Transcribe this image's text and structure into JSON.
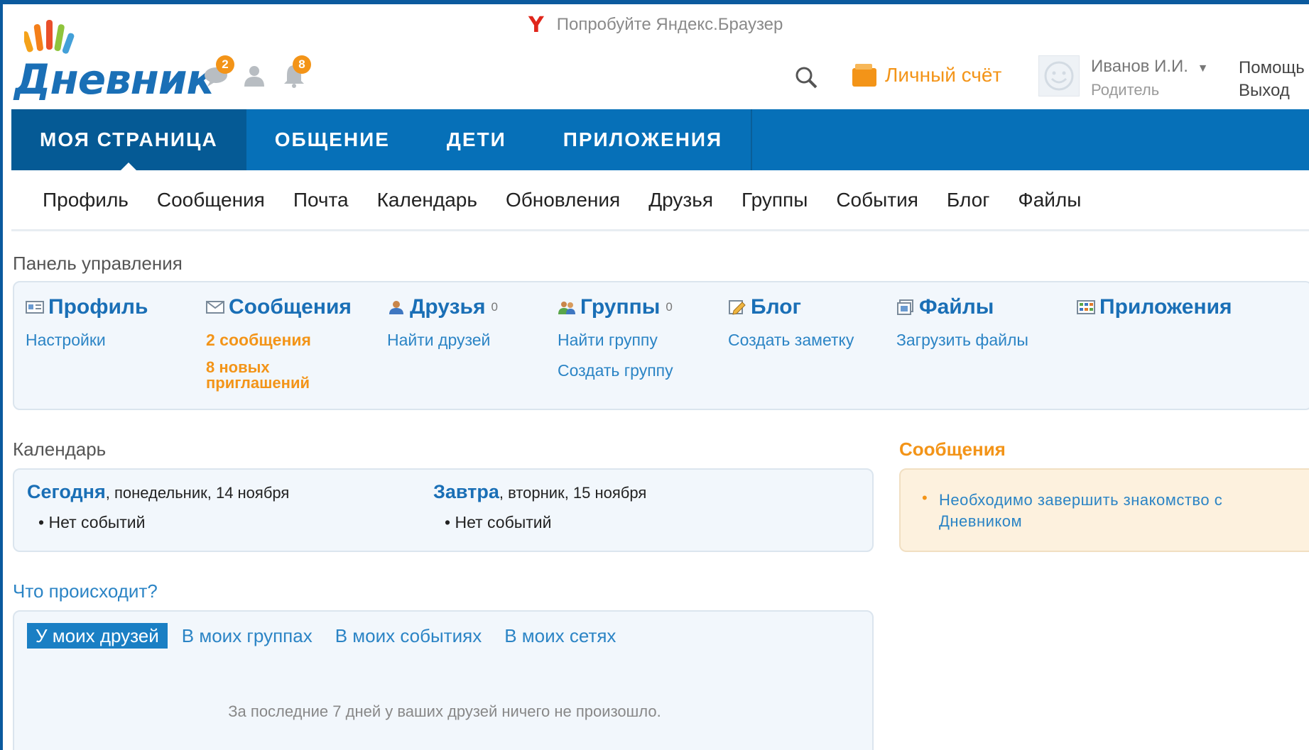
{
  "promo": {
    "text": "Попробуйте Яндекс.Браузер"
  },
  "logo": {
    "text": "Дневник"
  },
  "header": {
    "messages_badge": "2",
    "notifications_badge": "8",
    "account_label": "Личный счёт",
    "user_name": "Иванов И.И.",
    "user_role": "Родитель",
    "help_link": "Помощь",
    "logout_link": "Выход"
  },
  "main_nav": [
    {
      "label": "МОЯ СТРАНИЦА"
    },
    {
      "label": "ОБЩЕНИЕ"
    },
    {
      "label": "ДЕТИ"
    },
    {
      "label": "ПРИЛОЖЕНИЯ"
    }
  ],
  "sub_nav": [
    {
      "label": "Профиль"
    },
    {
      "label": "Сообщения"
    },
    {
      "label": "Почта"
    },
    {
      "label": "Календарь"
    },
    {
      "label": "Обновления"
    },
    {
      "label": "Друзья"
    },
    {
      "label": "Группы"
    },
    {
      "label": "События"
    },
    {
      "label": "Блог"
    },
    {
      "label": "Файлы"
    }
  ],
  "panel": {
    "title": "Панель управления",
    "profile": {
      "title": "Профиль",
      "link1": "Настройки"
    },
    "messages": {
      "title": "Сообщения",
      "link1": "2 сообщения",
      "link2": "8 новых приглашений"
    },
    "friends": {
      "title": "Друзья",
      "count": "0",
      "link1": "Найти друзей"
    },
    "groups": {
      "title": "Группы",
      "count": "0",
      "link1": "Найти группу",
      "link2": "Создать группу"
    },
    "blog": {
      "title": "Блог",
      "link1": "Создать заметку"
    },
    "files": {
      "title": "Файлы",
      "link1": "Загрузить файлы"
    },
    "apps": {
      "title": "Приложения"
    }
  },
  "calendar": {
    "title": "Календарь",
    "today_label": "Сегодня",
    "today_date": ", понедельник, 14 ноября",
    "today_event": "Нет событий",
    "tomorrow_label": "Завтра",
    "tomorrow_date": ", вторник, 15 ноября",
    "tomorrow_event": "Нет событий"
  },
  "messages_box": {
    "title": "Сообщения",
    "item": "Необходимо завершить знакомство с Дневником"
  },
  "activity": {
    "title": "Что происходит?",
    "tabs": [
      {
        "label": "У моих друзей"
      },
      {
        "label": "В моих группах"
      },
      {
        "label": "В моих событиях"
      },
      {
        "label": "В моих сетях"
      }
    ],
    "empty_text": "За последние 7 дней у ваших друзей ничего не произошло."
  },
  "colors": {
    "nav_blue": "#0670b8",
    "nav_active": "#055a95",
    "link_blue": "#2b84c5",
    "accent_orange": "#f39418",
    "panel_bg": "#f2f7fc"
  }
}
